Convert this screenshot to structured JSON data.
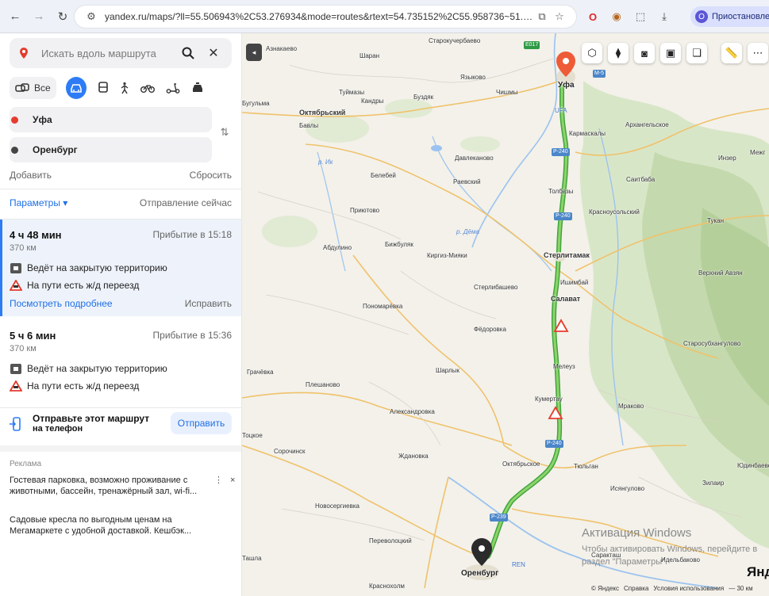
{
  "browser": {
    "url": "yandex.ru/maps/?ll=55.506943%2C53.276934&mode=routes&rtext=54.735152%2C55.958736~51.768205%2...",
    "profile_letter": "О",
    "profile_label": "Приостановлена"
  },
  "sidebar": {
    "search_placeholder": "Искать вдоль маршрута",
    "all_label": "Все",
    "from": "Уфа",
    "to": "Оренбург",
    "add_label": "Добавить",
    "reset_label": "Сбросить",
    "params_label": "Параметры ▾",
    "departure_label": "Отправление сейчас",
    "routes": [
      {
        "time": "4 ч 48 мин",
        "arrival": "Прибытие в 15:18",
        "distance": "370 км",
        "warn1": "Ведёт на закрытую территорию",
        "warn2": "На пути есть ж/д переезд",
        "more": "Посмотреть подробнее",
        "fix": "Исправить"
      },
      {
        "time": "5 ч 6 мин",
        "arrival": "Прибытие в 15:36",
        "distance": "370 км",
        "warn1": "Ведёт на закрытую территорию",
        "warn2": "На пути есть ж/д переезд"
      }
    ],
    "send": {
      "line1": "Отправьте этот маршрут",
      "line2": "на телефон",
      "button": "Отправить"
    },
    "ads": {
      "label": "Реклама",
      "ad1": "Гостевая парковка, возможно проживание с животными, бассейн, тренажёрный зал, wi-fi...",
      "ad2": "Садовые кресла по выгодным ценам на Мегамаркете с удобной доставкой. Кешбэк...",
      "menu": "⋮ ×"
    }
  },
  "map": {
    "towns": {
      "aznakaevo": "Азнакаево",
      "sharan": "Шаран",
      "starokuch": "Старокучербаево",
      "yazykovo": "Языково",
      "ufa": "Уфа",
      "ufa_lat": "UFA",
      "tuymazy": "Туймазы",
      "kandry": "Кандры",
      "buzdyak": "Буздяк",
      "chishmy": "Чишмы",
      "bugulma": "Бугульма",
      "oktyabrsky": "Октябрьский",
      "bavly": "Бавлы",
      "karmaskaly": "Кармаскалы",
      "arkhangelskoe": "Архангельское",
      "inzer": "Инзер",
      "mezh": "Межг",
      "davlekanovo": "Давлеканово",
      "belebey": "Белебей",
      "raevsky": "Раевский",
      "tolbazy": "Толбазы",
      "saitbaba": "Саитбаба",
      "priyutovo": "Приютово",
      "krasnousolsky": "Красноусольский",
      "tukan": "Тукан",
      "abdulino": "Абдулино",
      "bizhbulyak": "Бижбуляк",
      "kirgiz": "Киргиз-Мияки",
      "sterlitamak": "Стерлитамак",
      "ishimbay": "Ишимбай",
      "verkhny": "Верхний Авзян",
      "sterlibashevo": "Стерлибашево",
      "salavat": "Салават",
      "ponomarevka": "Пономарёвка",
      "fedorovka": "Фёдоровка",
      "starosubkhangulovo": "Старосубхангулово",
      "meleuz": "Мелеуз",
      "grachevka": "Грачёвка",
      "sharlyk": "Шарлык",
      "pleshanovo": "Плешаново",
      "kumertau": "Кумертау",
      "mrakovo": "Мраково",
      "aleksandrovka": "Александровка",
      "tockoe": "Тоцкое",
      "sorochinsk": "Сорочинск",
      "zhdanovka": "Ждановка",
      "oktyabrskoe": "Октябрьское",
      "tyulgan": "Тюльган",
      "yudinbaevo": "Юдинбаево",
      "zilair": "Зилаир",
      "isyangulovo": "Исянгулово",
      "novosergievka": "Новосергиевка",
      "perevolotsky": "Переволоцкий",
      "saraktash": "Саракташ",
      "ideljbakovo": "Идельбаково",
      "tashla": "Ташла",
      "orenburg": "Оренбург",
      "ren": "REN",
      "krasnokholm": "Красноxолм"
    },
    "rivers": {
      "ik": "р. Ик",
      "dema": "р. Дёма"
    },
    "shields": {
      "e017": "E017",
      "m5": "M-5",
      "r240a": "P-240",
      "r240b": "P-240",
      "r240c": "P-240",
      "r239": "P-239"
    },
    "watermark_title": "Активация Windows",
    "watermark_sub": "Чтобы активировать Windows, перейдите в раздел \"Параметры\".",
    "footer": [
      "© Яндекс",
      "Справка",
      "Условия использования",
      "— 30 км"
    ],
    "logo": "Янд"
  }
}
